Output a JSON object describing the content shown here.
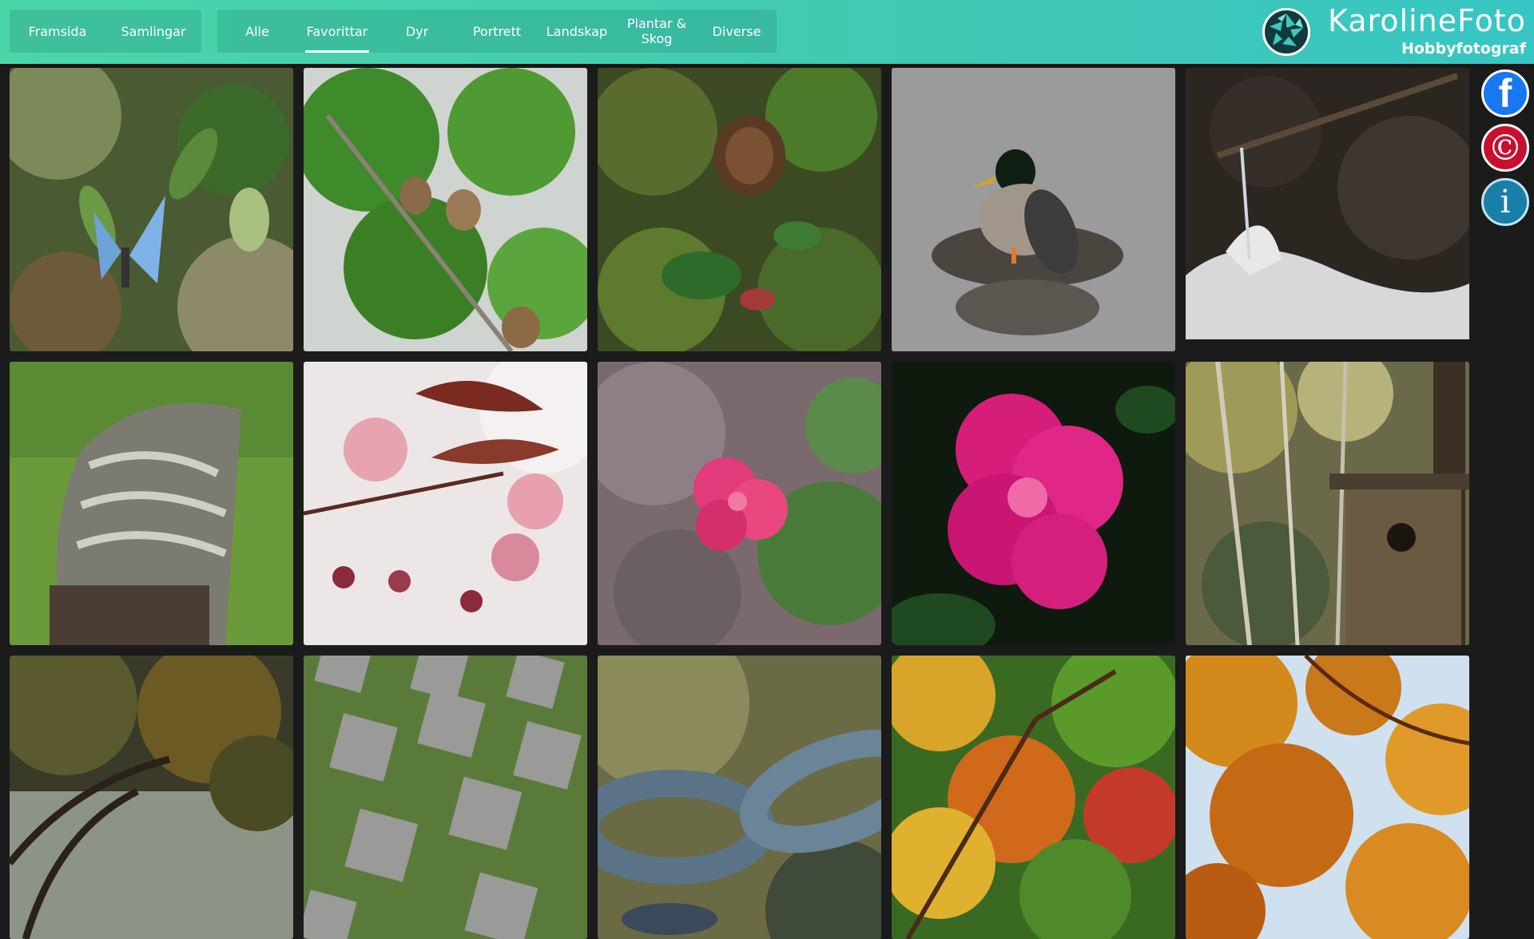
{
  "nav": {
    "primary": [
      {
        "label": "Framsida"
      },
      {
        "label": "Samlingar"
      }
    ],
    "categories": [
      {
        "label": "Alle"
      },
      {
        "label": "Favorittar"
      },
      {
        "label": "Dyr"
      },
      {
        "label": "Portrett"
      },
      {
        "label": "Landskap"
      },
      {
        "label": "Plantar & Skog"
      },
      {
        "label": "Diverse"
      }
    ],
    "active": "Favorittar"
  },
  "brand": {
    "title": "KarolineFoto",
    "subtitle": "Hobbyfotograf",
    "logo_icon": "camera-aperture-icon"
  },
  "side_buttons": [
    {
      "icon": "facebook-icon",
      "glyph": "f"
    },
    {
      "icon": "copyright-icon",
      "glyph": "©"
    },
    {
      "icon": "info-icon",
      "glyph": "i"
    }
  ],
  "colors": {
    "header_start": "#4bd6a9",
    "header_end": "#38c6c4",
    "background": "#1b1b1b",
    "facebook": "#1877f2",
    "copyright": "#c8102e",
    "info": "#1a7fa8"
  },
  "photos": [
    {
      "subject": "butterfly"
    },
    {
      "subject": "larch-cones"
    },
    {
      "subject": "pine-cone-forest-floor"
    },
    {
      "subject": "duck-on-rock"
    },
    {
      "subject": "waterfall"
    },
    {
      "subject": "tree-stump"
    },
    {
      "subject": "cherry-blossom"
    },
    {
      "subject": "pink-carnation"
    },
    {
      "subject": "rhododendron"
    },
    {
      "subject": "birdhouse"
    },
    {
      "subject": "tree-by-lake"
    },
    {
      "subject": "paving-moss"
    },
    {
      "subject": "chain"
    },
    {
      "subject": "autumn-leaves"
    },
    {
      "subject": "orange-canopy"
    }
  ]
}
